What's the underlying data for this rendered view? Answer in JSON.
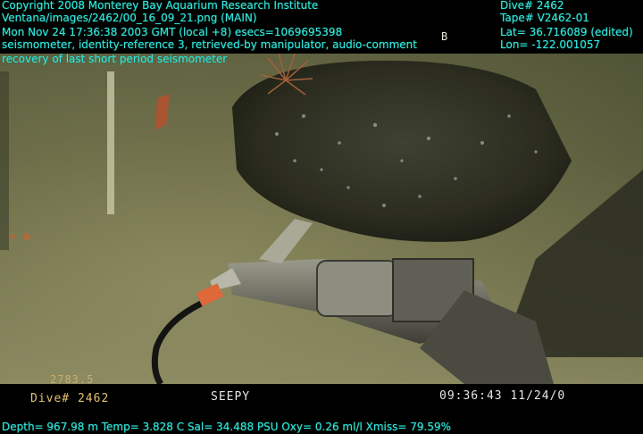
{
  "header_left": {
    "copyright": "Copyright 2008 Monterey Bay Aquarium Research Institute",
    "image_path": "Ventana/images/2462/00_16_09_21.png (MAIN)",
    "datetime": "Mon Nov 24 17:36:38 2003 GMT (local +8)  esecs=1069695398",
    "keywords": "seismometer, identity-reference 3, retrieved-by manipulator, audio-comment",
    "comment": "recovery of last short period seismometer"
  },
  "header_right": {
    "dive": "Dive# 2462",
    "tape": "Tape# V2462-01",
    "lat": "Lat= 36.716089 (edited)",
    "lon": "Lon= -122.001057"
  },
  "camera_overlay": {
    "marker": "B",
    "depth_code": "2783.5",
    "dive_label": "Dive# 2462",
    "vehicle": "SEEPY",
    "timecode": "09:36:43 11/24/0"
  },
  "footer": {
    "telemetry": "Depth= 967.98 m  Temp= 3.828 C  Sal= 34.488 PSU  Oxy= 0.26 ml/l  Xmiss= 79.59%"
  }
}
